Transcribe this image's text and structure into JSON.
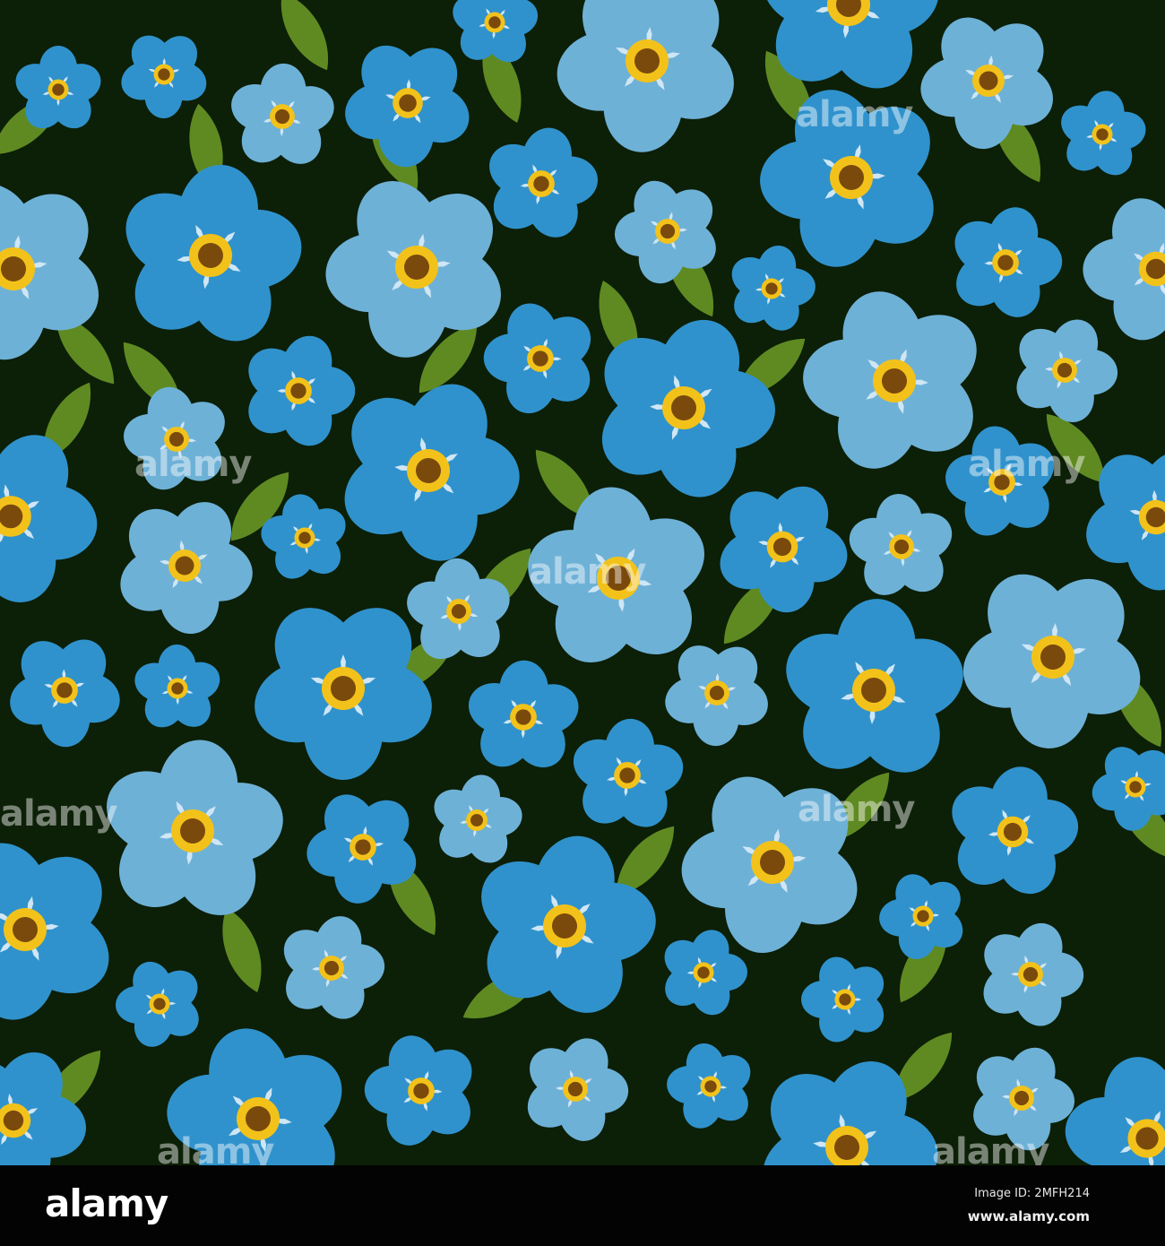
{
  "image": {
    "subject": "Seamless forget-me-not flower pattern",
    "colors": {
      "background": "#0c1f07",
      "petal_dark": "#3092cc",
      "petal_light": "#6eb1d7",
      "leaf": "#5f8a22",
      "center_ring": "#f2c21b",
      "center_dot": "#7a4a0c",
      "star": "#cfe6f5"
    }
  },
  "watermark": {
    "text": "alamy"
  },
  "footer": {
    "logo": "alamy",
    "image_id": "Image ID: 2MFH214",
    "url": "www.alamy.com"
  }
}
